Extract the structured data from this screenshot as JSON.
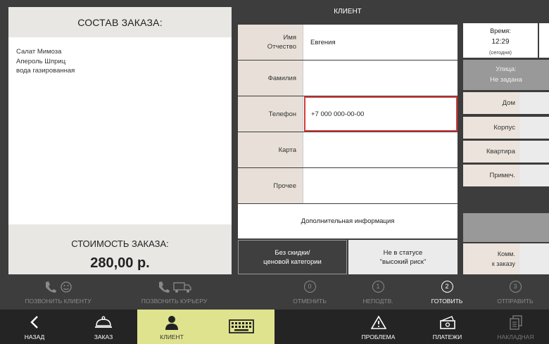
{
  "order": {
    "title": "СОСТАВ ЗАКАЗА:",
    "items": [
      "Салат Мимоза",
      "Апероль Шприц",
      "вода газированная"
    ],
    "cost_label": "СТОИМОСТЬ ЗАКАЗА:",
    "cost_value": "280,00 р."
  },
  "client": {
    "header": "КЛИЕНТ",
    "fields": [
      {
        "label_line1": "Имя",
        "label_line2": "Отчество",
        "value": "Евгения"
      },
      {
        "label_line1": "Фамилия",
        "label_line2": "",
        "value": ""
      },
      {
        "label_line1": "Телефон",
        "label_line2": "",
        "value": "+7 000 000-00-00"
      },
      {
        "label_line1": "Карта",
        "label_line2": "",
        "value": ""
      },
      {
        "label_line1": "Прочее",
        "label_line2": "",
        "value": ""
      }
    ],
    "extra_info": "Дополнительная информация",
    "discount_line1": "Без скидки/",
    "discount_line2": "ценовой категории",
    "risk_line1": "Не в статусе",
    "risk_line2": "\"высокий риск\""
  },
  "address": {
    "time_label": "Время:",
    "time_value": "12:29",
    "time_sub": "(сегодня)",
    "street_label": "Улица:",
    "street_value": "Не задана",
    "fields": [
      "Дом",
      "Корпус",
      "Квартира",
      "Примеч."
    ],
    "comment_line1": "Комм.",
    "comment_line2": "к заказу"
  },
  "actions": {
    "call_client": "ПОЗВОНИТЬ КЛИЕНТУ",
    "call_courier": "ПОЗВОНИТЬ КУРЬЕРУ",
    "steps": [
      {
        "num": "0",
        "label": "ОТМЕНИТЬ"
      },
      {
        "num": "1",
        "label": "НЕПОДТВ."
      },
      {
        "num": "2",
        "label": "ГОТОВИТЬ"
      },
      {
        "num": "3",
        "label": "ОТПРАВИТЬ"
      }
    ]
  },
  "nav": {
    "back": "НАЗАД",
    "order": "ЗАКАЗ",
    "client": "КЛИЕНТ",
    "problem": "ПРОБЛЕМА",
    "payments": "ПЛАТЕЖИ",
    "invoice": "НАКЛАДНАЯ"
  },
  "colors": {
    "accent": "#dfe38e",
    "focus_border": "#d33a3a",
    "background": "#3d3d3d"
  }
}
